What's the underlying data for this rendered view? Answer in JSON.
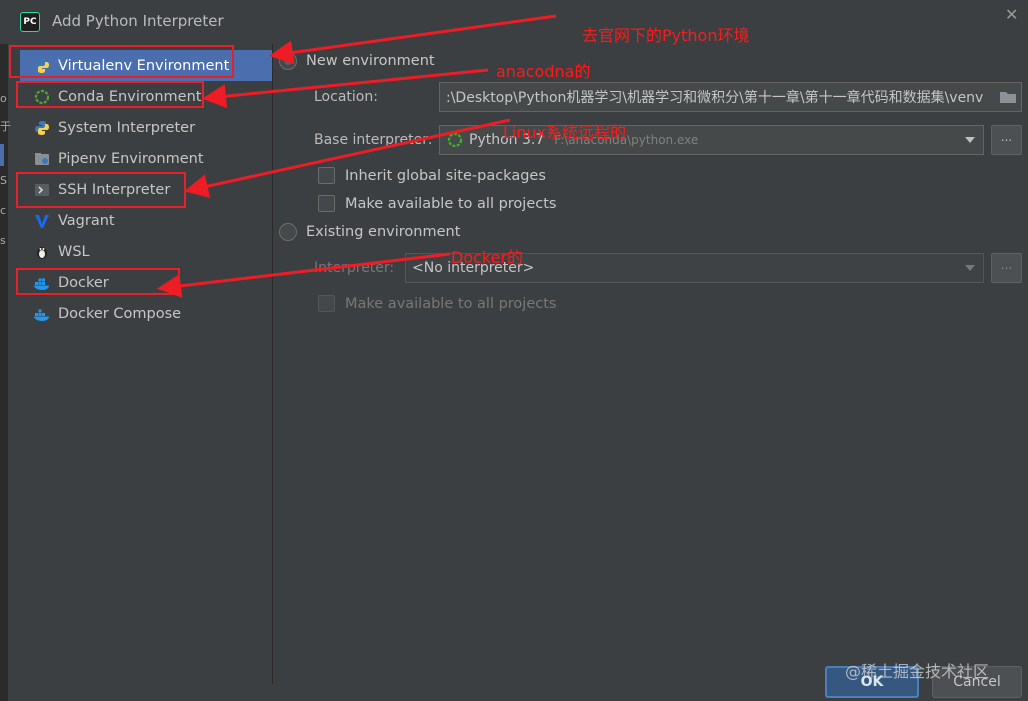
{
  "window": {
    "title": "Add Python Interpreter",
    "app_icon_text": "PC",
    "close_glyph": "✕"
  },
  "left_edge_chars": [
    "o",
    "于",
    "S",
    "c",
    "s"
  ],
  "sidebar": {
    "items": [
      {
        "label": "Virtualenv Environment",
        "icon": "virtualenv-icon",
        "selected": true
      },
      {
        "label": "Conda Environment",
        "icon": "conda-icon"
      },
      {
        "label": "System Interpreter",
        "icon": "python-icon"
      },
      {
        "label": "Pipenv Environment",
        "icon": "pipenv-icon"
      },
      {
        "label": "SSH Interpreter",
        "icon": "ssh-icon"
      },
      {
        "label": "Vagrant",
        "icon": "vagrant-icon"
      },
      {
        "label": "WSL",
        "icon": "linux-icon"
      },
      {
        "label": "Docker",
        "icon": "docker-icon"
      },
      {
        "label": "Docker Compose",
        "icon": "docker-compose-icon"
      }
    ]
  },
  "new_env": {
    "label": "New environment",
    "selected": true,
    "location_label": "Location:",
    "location_value": ":\\Desktop\\Python机器学习\\机器学习和微积分\\第十一章\\第十一章代码和数据集\\venv",
    "base_label": "Base interpreter:",
    "base_value": "Python 3.7",
    "base_path": "F:\\anaconda\\python.exe",
    "browse": "...",
    "inherit_label": "Inherit global site-packages",
    "available_label": "Make available to all projects"
  },
  "existing_env": {
    "label": "Existing environment",
    "interpreter_label": "Interpreter:",
    "interpreter_value": "<No interpreter>",
    "browse": "...",
    "available_label": "Make available to all projects"
  },
  "buttons": {
    "ok": "OK",
    "cancel": "Cancel"
  },
  "annotations": {
    "virtualenv": "去官网下的Python环境",
    "conda": "anacodna的",
    "ssh": "Linux系统远程的",
    "docker": "Docker的"
  },
  "watermark": "@稀土掘金技术社区",
  "colors": {
    "selection": "#4b6eaf",
    "annotation": "#ff1a1a",
    "background": "#3c3f41"
  }
}
